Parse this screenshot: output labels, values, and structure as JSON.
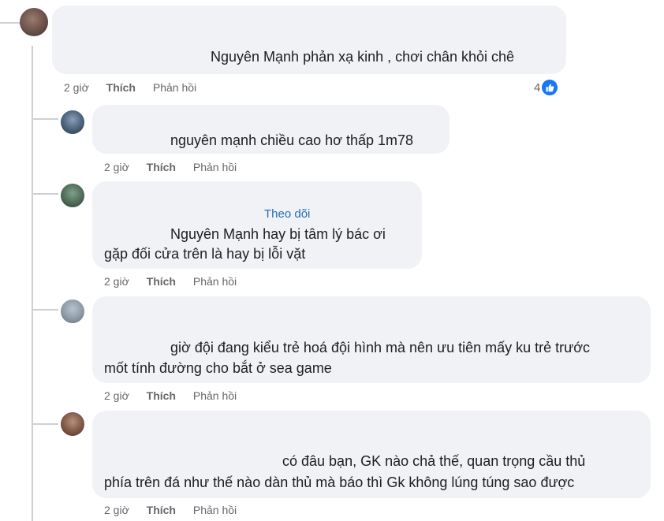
{
  "comments": [
    {
      "text_lines": [
        "Nguyên Mạnh phản xạ kinh    , chơi chân khỏi chê"
      ],
      "time": "2 giờ",
      "like": "Thích",
      "reply": "Phản hồi",
      "reaction_count": "4",
      "reaction_icon": "like-icon"
    },
    {
      "text_lines": [
        "nguyên mạnh chiều cao hơ thấp 1m78"
      ],
      "time": "2 giờ",
      "like": "Thích",
      "reply": "Phản hồi"
    },
    {
      "follow_label": "Theo dõi",
      "text_lines": [
        "Nguyên Mạnh hay bị tâm lý bác ơi",
        "gặp đối cửa trên là hay bị lỗi vặt"
      ],
      "time": "2 giờ",
      "like": "Thích",
      "reply": "Phản hồi"
    },
    {
      "text_lines": [
        "giờ đội đang kiểu trẻ hoá đội hình mà nên ưu tiên mấy ku trẻ trước",
        "mốt tính đường cho bắt ở sea game"
      ],
      "time": "2 giờ",
      "like": "Thích",
      "reply": "Phản hồi"
    },
    {
      "text_lines": [
        "có đâu bạn, GK nào chả thế, quan trọng cầu thủ",
        "phía trên đá như thế nào dàn thủ mà báo thì Gk không lúng túng sao được"
      ],
      "time": "2 giờ",
      "like": "Thích",
      "reply": "Phản hồi"
    }
  ],
  "colors": {
    "bubble_bg": "#f0f2f5",
    "meta_text": "#65676b",
    "follow_link": "#1f6fb5",
    "like_badge": "#1877f2",
    "thread_line": "#ced0d4"
  }
}
